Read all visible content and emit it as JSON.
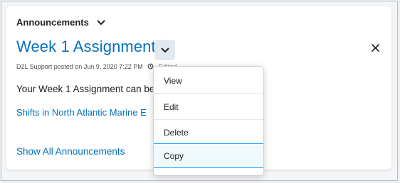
{
  "widget": {
    "title": "Announcements"
  },
  "announcement": {
    "title": "Week 1 Assignment",
    "meta": "D2L Support posted on Jun 9, 2020 7:22 PM",
    "edited": "Edited",
    "body": "Your Week 1 Assignment can be",
    "link": "Shifts in North Atlantic Marine E"
  },
  "footer": {
    "show_all": "Show All Announcements"
  },
  "context_menu": {
    "items": [
      {
        "label": "View"
      },
      {
        "label": "Edit"
      },
      {
        "label": "Delete"
      },
      {
        "label": "Copy"
      }
    ],
    "highlighted": "Copy"
  },
  "colors": {
    "link": "#006fbf",
    "menu_highlight_border": "#29a6ff",
    "menu_highlight_bg": "#f0fafd"
  },
  "icons": {
    "header_toggle": "chevron-down-icon",
    "context_toggle": "chevron-down-icon",
    "close": "close-icon",
    "edited": "edited-icon"
  }
}
